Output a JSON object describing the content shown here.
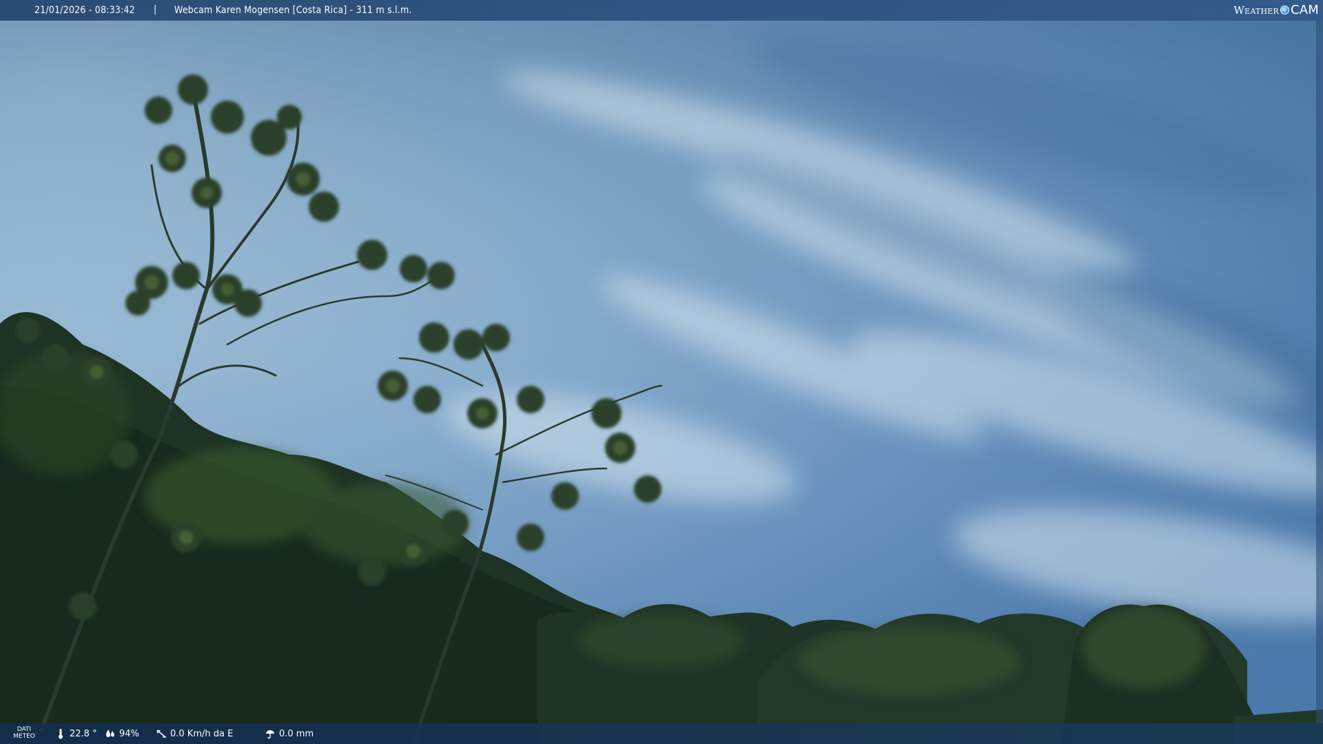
{
  "header": {
    "datetime": "21/01/2026 - 08:33:42",
    "separator": "|",
    "title": "Webcam Karen Mogensen [Costa Rica] - 311 m s.l.m.",
    "brand_left": "Weather",
    "brand_right": "CAM"
  },
  "footer": {
    "label_line1": "DATI",
    "label_line2": "METEO",
    "temperature": "22.8 °",
    "humidity": "94%",
    "wind": "0.0 Km/h da E",
    "rain": "0.0 mm"
  },
  "icons": {
    "temperature": "thermometer-icon",
    "humidity": "drops-icon",
    "wind": "wind-vane-icon",
    "rain": "rain-icon"
  },
  "colors": {
    "sky_top": "#3f6fa3",
    "sky_haze": "#b8d6e6",
    "foliage_dark": "#16251c",
    "foliage_light": "#5b7a3a",
    "bar": "#1e3e68"
  }
}
